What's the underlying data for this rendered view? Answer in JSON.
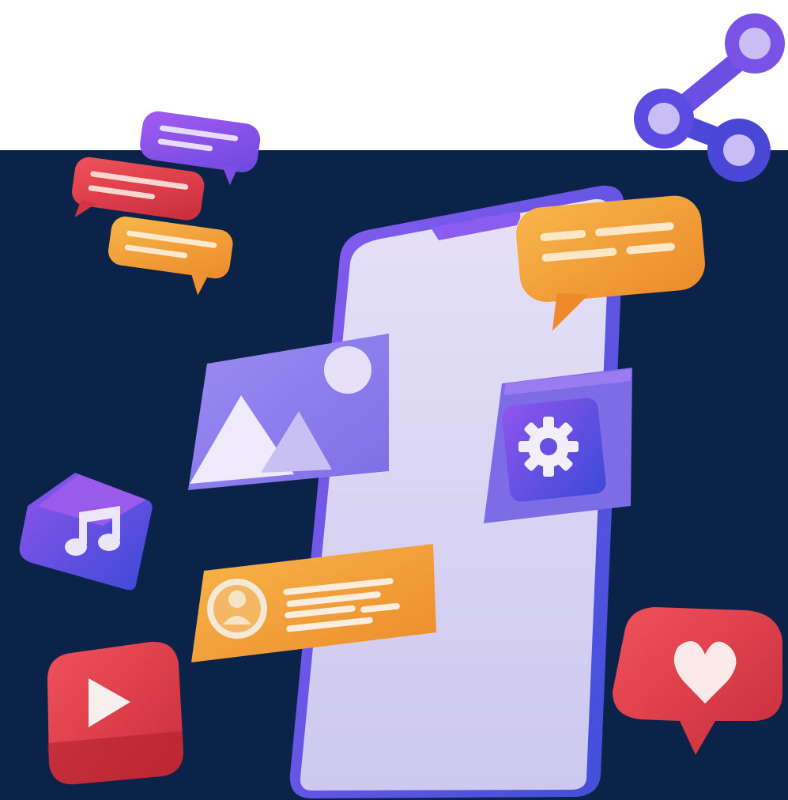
{
  "colors": {
    "navy_background": "#0b2348",
    "top_background": "#ffffff",
    "phone_frame": "#6d4fe0",
    "phone_screen": "#d9d3f5",
    "bubble_purple": "#9b56e8",
    "bubble_red": "#e8404a",
    "bubble_orange": "#f2a43a",
    "icon_red": "#e93a47",
    "icon_purple_blue": "#5a4ee0",
    "text_lines": "#fbe9d6"
  },
  "icons": [
    "share-icon",
    "chat-bubble-icon",
    "image-icon",
    "gear-icon",
    "music-note-icon",
    "play-icon",
    "heart-icon",
    "user-profile-icon",
    "smartphone-icon"
  ]
}
